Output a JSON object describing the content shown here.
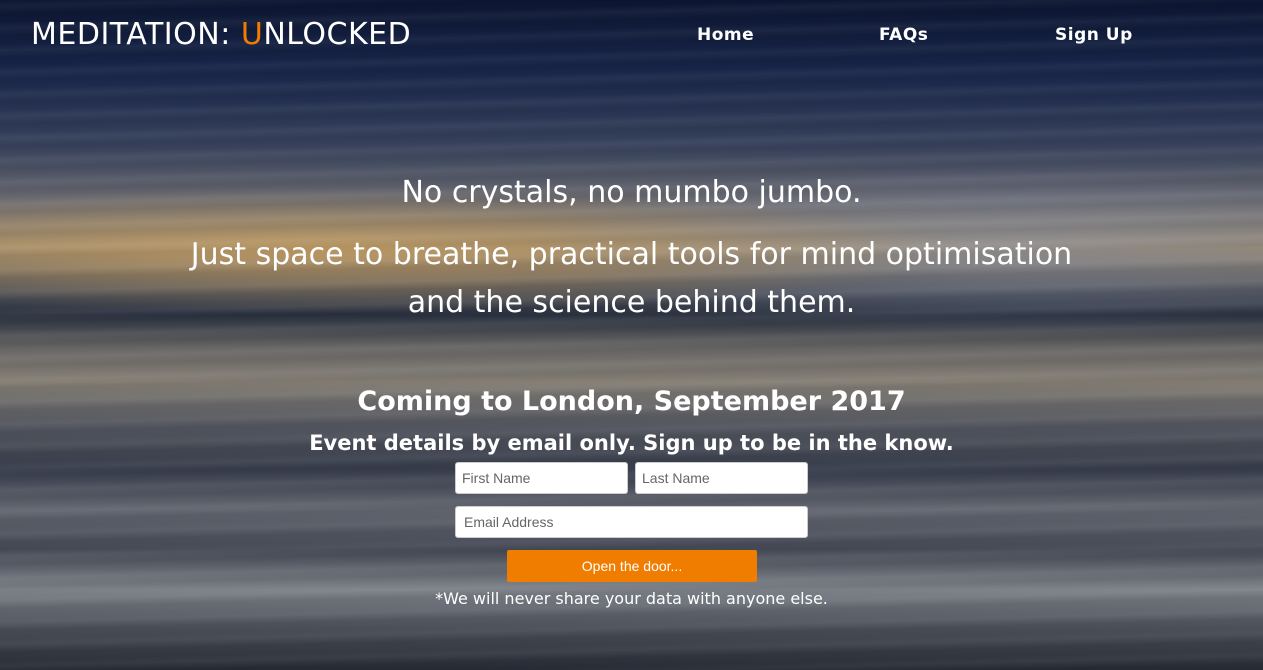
{
  "header": {
    "logo_pre": "MEDITATION: ",
    "logo_accent": "U",
    "logo_post": "NLOCKED"
  },
  "nav": {
    "home": "Home",
    "faqs": "FAQs",
    "signup": "Sign Up"
  },
  "hero": {
    "line1": "No crystals, no mumbo jumbo.",
    "line2a": "Just space to breathe, practical tools for mind optimisation",
    "line2b": "and the science behind them."
  },
  "event": {
    "title": "Coming to London, September 2017",
    "subtitle": "Event details by email only. Sign up to be in the know."
  },
  "form": {
    "first_name_placeholder": "First Name",
    "last_name_placeholder": "Last Name",
    "email_placeholder": "Email Address",
    "submit_label": "Open the door...",
    "disclaimer": "*We will never share your data with anyone else."
  },
  "colors": {
    "accent": "#f07c00",
    "text": "#ffffff"
  }
}
